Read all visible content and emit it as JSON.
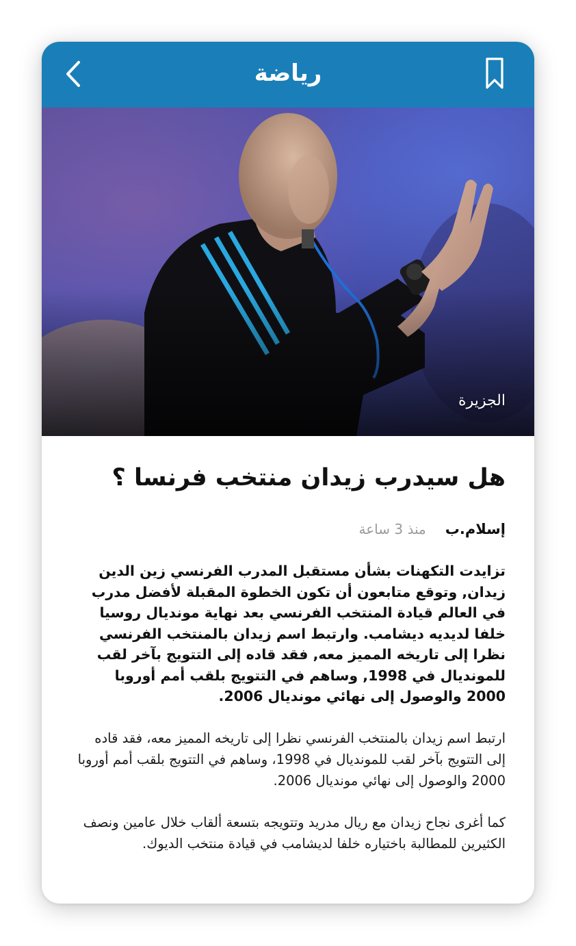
{
  "header": {
    "title": "رياضة",
    "background": "#1a7fb8",
    "back_icon": "chevron-left-icon",
    "bookmark_icon": "bookmark-icon"
  },
  "hero": {
    "photo_credit": "الجزيرة"
  },
  "article": {
    "headline": "هل سيدرب زيدان منتخب فرنسا ؟",
    "author": "إسلام.ب",
    "time": "منذ 3 ساعة",
    "lead": "تزايدت التكهنات بشأن مستقبل المدرب الفرنسي زين الدين زيدان, وتوقع متابعون أن تكون الخطوة المقبلة لأفضل مدرب في العالم قيادة المنتخب الفرنسي بعد نهاية مونديال روسيا خلفا لديديه ديشامب. وارتبط اسم زيدان بالمنتخب الفرنسي نظرا إلى تاريخه المميز معه, فقد قاده إلى التتويج بآخر لقب للمونديال في 1998, وساهم في التتويج بلقب أمم أوروبا 2000 والوصول إلى نهائي مونديال 2006.",
    "paragraphs": [
      "ارتبط اسم زيدان بالمنتخب الفرنسي نظرا إلى تاريخه المميز معه، فقد قاده إلى التتويج بآخر لقب للمونديال في 1998، وساهم في التتويج بلقب أمم أوروبا 2000 والوصول إلى نهائي مونديال 2006.",
      "كما أغرى نجاح زيدان مع ريال مدريد وتتويجه بتسعة ألقاب خلال عامين ونصف الكثيرين للمطالبة باختياره خلفا لديشامب في قيادة منتخب الديوك."
    ]
  }
}
